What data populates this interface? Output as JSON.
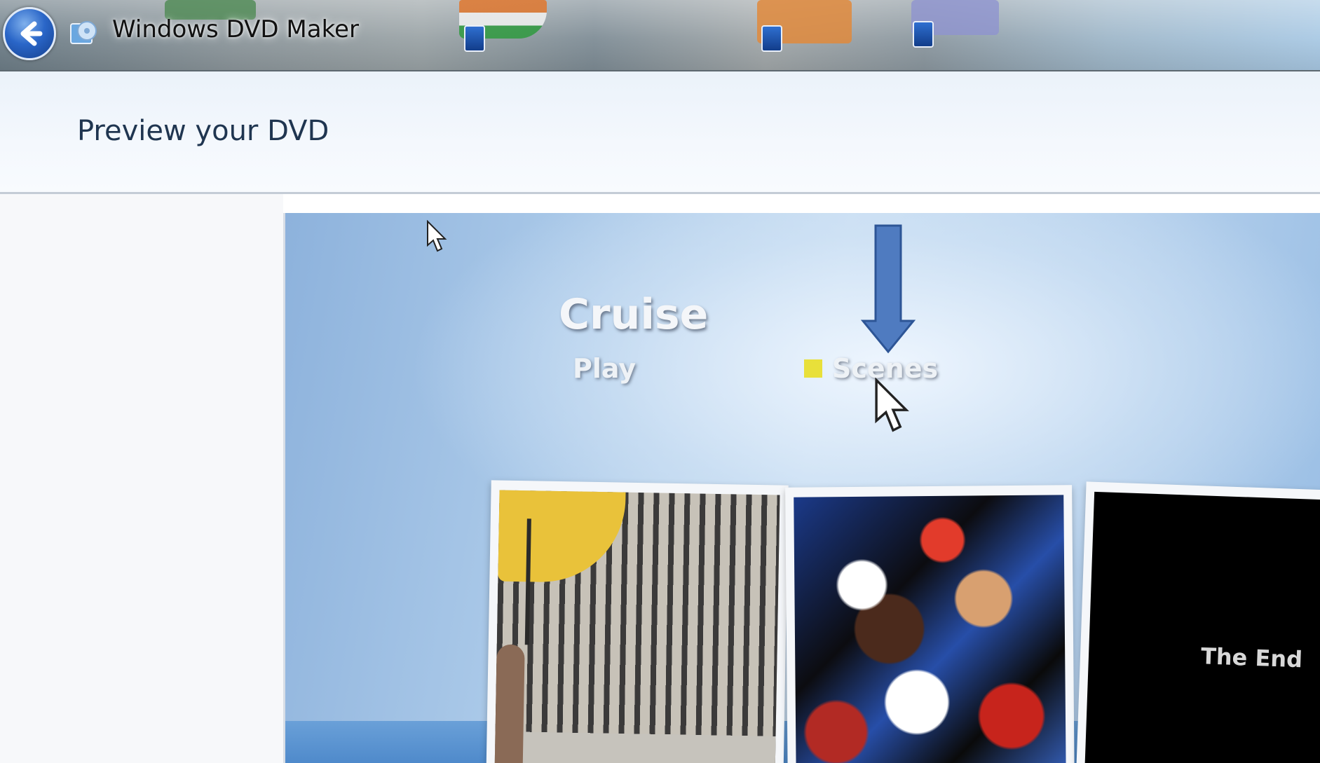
{
  "window": {
    "app_title": "Windows DVD Maker",
    "back_button_icon": "back-arrow-icon",
    "app_icon": "dvd-maker-icon"
  },
  "header": {
    "page_title": "Preview your DVD"
  },
  "preview": {
    "menu_title": "Cruise",
    "menu_items": [
      {
        "label": "Play",
        "selected": false
      },
      {
        "label": "Scenes",
        "selected": true
      }
    ],
    "selection_color": "#e8e03a",
    "thumbnails": [
      {
        "content": "venice-square-photo"
      },
      {
        "content": "crowd-photo"
      },
      {
        "caption": "The End"
      }
    ],
    "annotation_arrow_color": "#4f7bc0"
  },
  "colors": {
    "accent": "#2a66c8",
    "header_bg": "#ebf2fa",
    "title_text": "#1f3550"
  }
}
